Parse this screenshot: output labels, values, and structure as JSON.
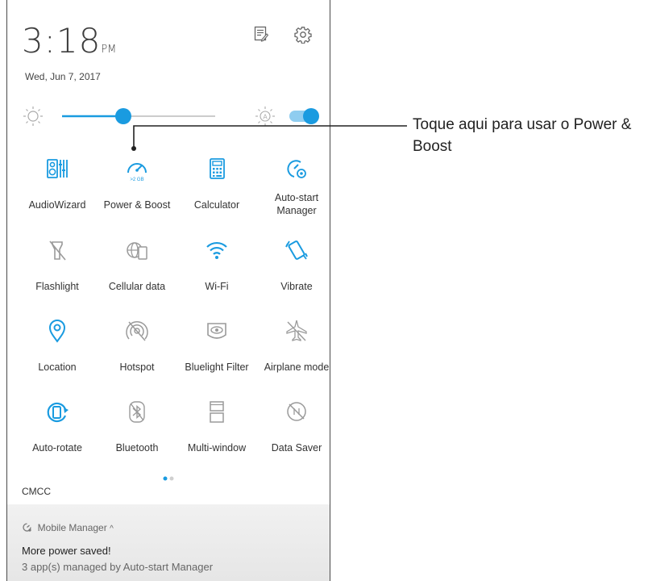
{
  "status": {
    "time": "3:18",
    "ampm": "PM",
    "date": "Wed, Jun 7, 2017"
  },
  "header_icons": [
    "notes-icon",
    "settings-gear-icon"
  ],
  "brightness": {
    "level": 0.4,
    "auto_enabled": true
  },
  "tiles": [
    {
      "label": "AudioWizard",
      "icon": "audio-wizard-icon",
      "active": true
    },
    {
      "label": "Power & Boost",
      "icon": "power-boost-gauge-icon",
      "active": true,
      "sub": ">2 GB"
    },
    {
      "label": "Calculator",
      "icon": "calculator-icon",
      "active": true
    },
    {
      "label": "Auto-start Manager",
      "icon": "auto-start-manager-icon",
      "active": true
    },
    {
      "label": "Flashlight",
      "icon": "flashlight-off-icon",
      "active": false
    },
    {
      "label": "Cellular data",
      "icon": "cellular-data-icon",
      "active": false
    },
    {
      "label": "Wi-Fi",
      "icon": "wifi-icon",
      "active": true
    },
    {
      "label": "Vibrate",
      "icon": "vibrate-icon",
      "active": true
    },
    {
      "label": "Location",
      "icon": "location-pin-icon",
      "active": true
    },
    {
      "label": "Hotspot",
      "icon": "hotspot-off-icon",
      "active": false
    },
    {
      "label": "Bluelight Filter",
      "icon": "bluelight-filter-icon",
      "active": false
    },
    {
      "label": "Airplane mode",
      "icon": "airplane-icon",
      "active": false
    },
    {
      "label": "Auto-rotate",
      "icon": "auto-rotate-icon",
      "active": true
    },
    {
      "label": "Bluetooth",
      "icon": "bluetooth-off-icon",
      "active": false
    },
    {
      "label": "Multi-window",
      "icon": "multi-window-icon",
      "active": false
    },
    {
      "label": "Data Saver",
      "icon": "data-saver-off-icon",
      "active": false
    }
  ],
  "page_indicator": {
    "pages": 2,
    "current": 1
  },
  "carrier": "CMCC",
  "notification": {
    "app": "Mobile Manager",
    "title": "More power saved!",
    "body": "3 app(s) managed by Auto-start Manager"
  },
  "callout": {
    "text": "Toque aqui para usar o Power & Boost"
  },
  "colors": {
    "accent": "#1a9be0",
    "inactive": "#9a9a9a",
    "text": "#333333"
  }
}
